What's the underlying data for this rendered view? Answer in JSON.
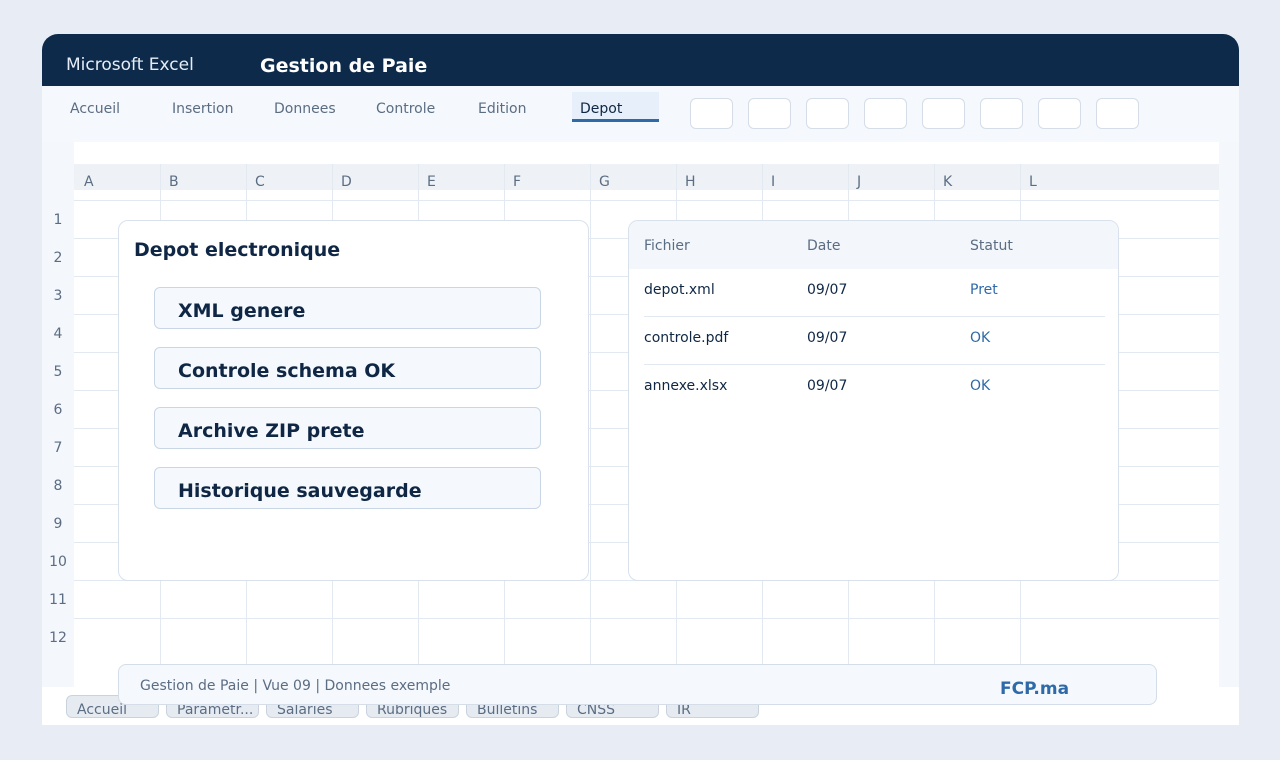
{
  "window": {
    "app_name": "Microsoft Excel",
    "doc_title": "Gestion de Paie"
  },
  "ribbon": {
    "tabs": [
      {
        "label": "Accueil",
        "active": false
      },
      {
        "label": "Insertion",
        "active": false
      },
      {
        "label": "Donnees",
        "active": false
      },
      {
        "label": "Controle",
        "active": false
      },
      {
        "label": "Edition",
        "active": false
      },
      {
        "label": "Depot",
        "active": true
      }
    ],
    "button_count": 8
  },
  "grid": {
    "columns": [
      "A",
      "B",
      "C",
      "D",
      "E",
      "F",
      "G",
      "H",
      "I",
      "J",
      "K",
      "L"
    ],
    "rows": [
      "1",
      "2",
      "3",
      "4",
      "5",
      "6",
      "7",
      "8",
      "9",
      "10",
      "11",
      "12"
    ]
  },
  "depot_panel": {
    "title": "Depot electronique",
    "steps": [
      "XML genere",
      "Controle schema OK",
      "Archive ZIP prete",
      "Historique sauvegarde"
    ]
  },
  "files_table": {
    "headers": [
      "Fichier",
      "Date",
      "Statut"
    ],
    "rows": [
      [
        "depot.xml",
        "09/07",
        "Pret"
      ],
      [
        "controle.pdf",
        "09/07",
        "OK"
      ],
      [
        "annexe.xlsx",
        "09/07",
        "OK"
      ]
    ]
  },
  "status_bar": {
    "text": "Gestion de Paie | Vue 09 | Donnees exemple",
    "brand": "FCP.ma"
  },
  "sheet_tabs": [
    "Accueil",
    "Parametr...",
    "Salaries",
    "Rubriques",
    "Bulletins",
    "CNSS",
    "IR"
  ],
  "colors": {
    "titlebar": "#0d2a4a",
    "accent": "#2f6aa8",
    "text": "#0f2744",
    "muted": "#5b6d83"
  }
}
